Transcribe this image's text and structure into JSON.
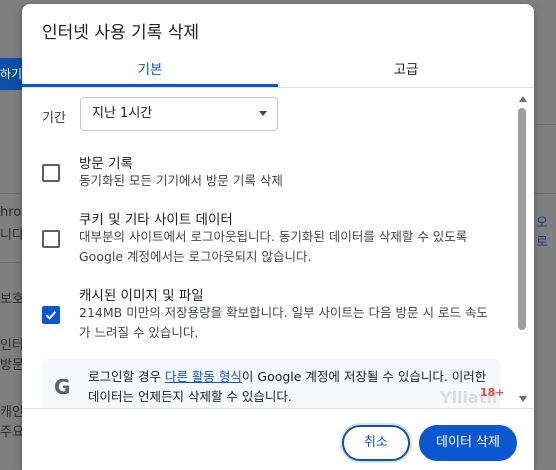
{
  "background": {
    "left_button_fragment": "하기",
    "fragments": [
      "hron",
      "니다",
      "보호",
      "인터",
      "방문",
      "캐인",
      "주요",
      "오로"
    ]
  },
  "dialog": {
    "title": "인터넷 사용 기록 삭제",
    "tabs": [
      {
        "label": "기본",
        "selected": true
      },
      {
        "label": "고급",
        "selected": false
      }
    ],
    "period": {
      "label": "기간",
      "value": "지난 1시간"
    },
    "options": [
      {
        "title": "방문 기록",
        "description": "동기화된 모든 기기에서 방문 기록 삭제",
        "checked": false
      },
      {
        "title": "쿠키 및 기타 사이트 데이터",
        "description": "대부분의 사이트에서 로그아웃됩니다. 동기화된 데이터를 삭제할 수 있도록 Google 계정에서는 로그아웃되지 않습니다.",
        "checked": false
      },
      {
        "title": "캐시된 이미지 및 파일",
        "description": "214MB 미만의 저장용량을 확보합니다. 일부 사이트는 다음 방문 시 로드 속도가 느려질 수 있습니다.",
        "checked": true
      }
    ],
    "info": {
      "icon": "google-g-icon",
      "text_before": "로그인할 경우 ",
      "link": "다른 활동 형식",
      "text_after": "이 Google 계정에 저장될 수 있습니다. 이러한 데이터는 언제든지 삭제할 수 있습니다."
    },
    "buttons": {
      "cancel": "취소",
      "delete": "데이터 삭제"
    },
    "accent_color": "#0b57d0"
  },
  "overlay": {
    "watermark": "Ylliatli",
    "badge": "18+"
  }
}
